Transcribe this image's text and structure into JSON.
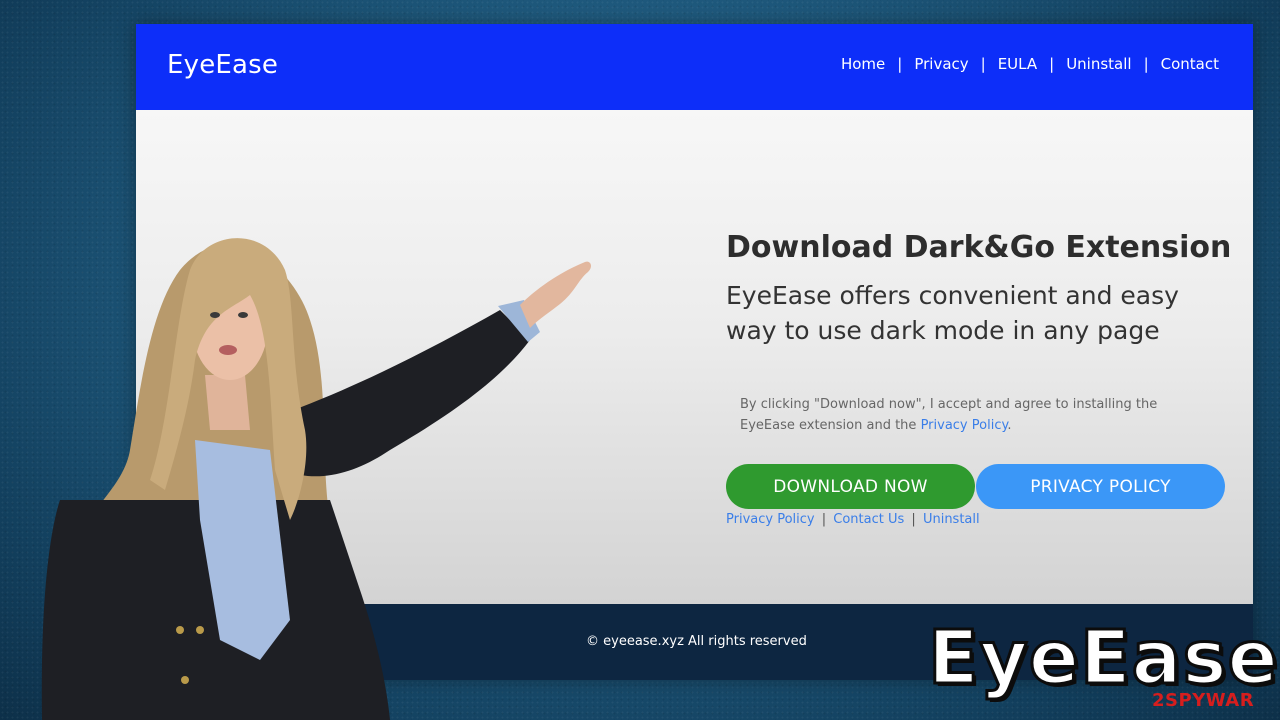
{
  "site": {
    "logo": "EyeEase",
    "nav": [
      {
        "label": "Home"
      },
      {
        "label": "Privacy"
      },
      {
        "label": "EULA"
      },
      {
        "label": "Uninstall"
      },
      {
        "label": "Contact"
      }
    ],
    "nav_separator": "|"
  },
  "hero": {
    "title": "Download Dark&Go Extension",
    "subtitle": "EyeEase offers convenient and easy way to use dark mode in any page",
    "consent_text": "By clicking \"Download now\", I accept and agree to installing the EyeEase extension and the",
    "consent_link": "Privacy Policy",
    "consent_end": ".",
    "download_button": "DOWNLOAD NOW",
    "privacy_button": "PRIVACY POLICY",
    "links": [
      {
        "label": "Privacy Policy"
      },
      {
        "label": "Contact Us"
      },
      {
        "label": "Uninstall"
      }
    ],
    "links_separator": "|"
  },
  "footer": {
    "text": "© eyeease.xyz All rights reserved"
  },
  "overlay": {
    "brand_title": "EyeEase",
    "watermark_num": "2",
    "watermark_text": "SPYWAR"
  },
  "colors": {
    "header_blue": "#0d2ef9",
    "download_green": "#2f9a2f",
    "privacy_blue": "#3b97f7",
    "footer_navy": "#0d2641",
    "link_blue": "#3a7ee8"
  },
  "icons": [
    "person-image"
  ]
}
